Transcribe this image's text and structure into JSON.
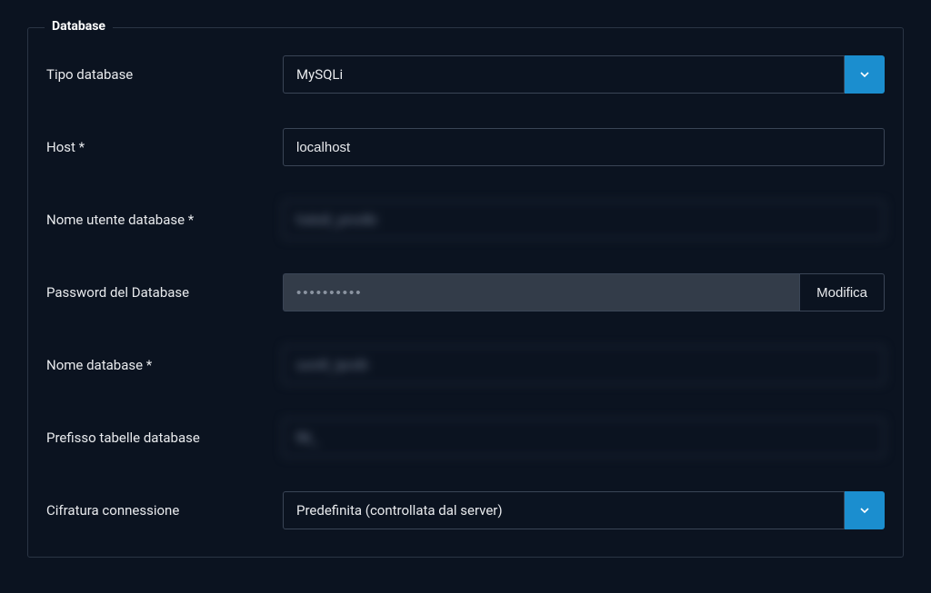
{
  "section": {
    "title": "Database"
  },
  "fields": {
    "db_type": {
      "label": "Tipo database",
      "value": "MySQLi"
    },
    "host": {
      "label": "Host *",
      "value": "localhost"
    },
    "username": {
      "label": "Nome utente database *",
      "value": "hxksll_prxvlki"
    },
    "password": {
      "label": "Password del Database",
      "value": "••••••••••",
      "button_label": "Modifica"
    },
    "dbname": {
      "label": "Nome database *",
      "value": "sxmfl_lprxfii"
    },
    "prefix": {
      "label": "Prefisso tabelle database",
      "value": "fl8_"
    },
    "encryption": {
      "label": "Cifratura connessione",
      "value": "Predefinita (controllata dal server)"
    }
  }
}
